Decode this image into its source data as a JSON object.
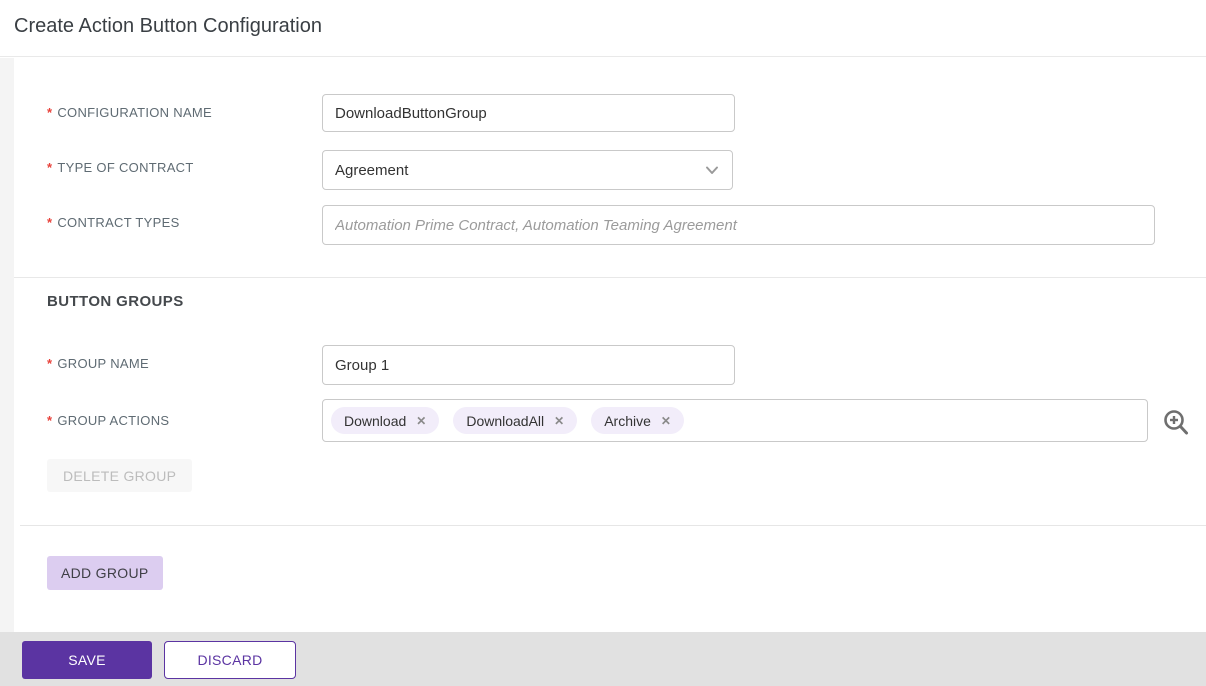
{
  "header": {
    "title": "Create Action Button Configuration"
  },
  "form": {
    "configuration_name": {
      "required": "*",
      "label": "CONFIGURATION NAME",
      "value": "DownloadButtonGroup"
    },
    "type_of_contract": {
      "required": "*",
      "label": "TYPE OF CONTRACT",
      "value": "Agreement"
    },
    "contract_types": {
      "required": "*",
      "label": "CONTRACT TYPES",
      "placeholder": "Automation Prime Contract, Automation Teaming Agreement"
    }
  },
  "button_groups": {
    "section_title": "BUTTON GROUPS",
    "group_name": {
      "required": "*",
      "label": "GROUP NAME",
      "value": "Group 1"
    },
    "group_actions": {
      "required": "*",
      "label": "GROUP ACTIONS",
      "tags": [
        "Download",
        "DownloadAll",
        "Archive"
      ],
      "remove_icon": "✕"
    },
    "delete_group_label": "DELETE GROUP",
    "add_group_label": "ADD GROUP"
  },
  "footer": {
    "save_label": "SAVE",
    "discard_label": "DISCARD"
  },
  "colors": {
    "primary_purple": "#5b34a2",
    "lavender_button": "#dccdf0",
    "tag_background": "#f2edfa",
    "required_red": "#e8413a",
    "footer_background": "#e1e1e1"
  }
}
